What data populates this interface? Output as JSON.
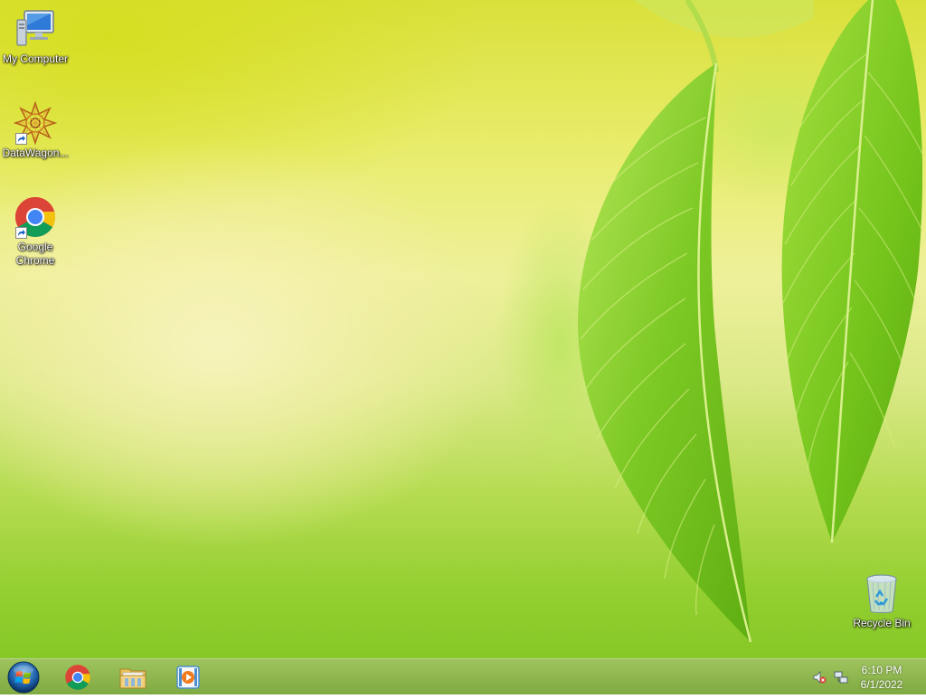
{
  "desktop": {
    "icons": [
      {
        "label": "My Computer",
        "icon": "computer-icon"
      },
      {
        "label": "DataWagon...",
        "icon": "datawagon-icon"
      },
      {
        "label": "Google Chrome",
        "label_line1": "Google",
        "label_line2": "Chrome",
        "icon": "chrome-icon"
      },
      {
        "label": "Recycle Bin",
        "icon": "recycle-bin-icon"
      }
    ]
  },
  "taskbar": {
    "start": {
      "icon": "windows-start-icon"
    },
    "pinned": [
      {
        "name": "Google Chrome",
        "icon": "chrome-icon"
      },
      {
        "name": "File Explorer",
        "icon": "folder-icon"
      },
      {
        "name": "Media Player",
        "icon": "media-player-icon"
      }
    ],
    "tray": {
      "volume_icon": "volume-muted-icon",
      "network_icon": "network-icon"
    },
    "clock": {
      "time": "6:10 PM",
      "date": "6/1/2022"
    }
  },
  "colors": {
    "taskbar": "#86b148",
    "wallpaper_light": "#eef09a",
    "wallpaper_leaf": "#7cc21e"
  }
}
